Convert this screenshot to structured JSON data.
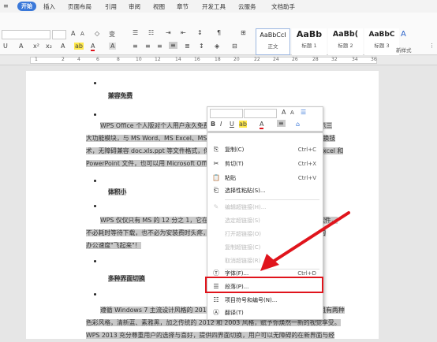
{
  "menubar": {
    "start": "开始",
    "items": [
      "插入",
      "页面布局",
      "引用",
      "审阅",
      "视图",
      "章节",
      "开发工具",
      "云服务",
      "文档助手"
    ]
  },
  "ribbon": {
    "font_size_up": "A",
    "font_size_down": "A",
    "clear": "◇",
    "phonetic": "变",
    "styles": [
      {
        "sample": "AaBbCcI",
        "label": "正文"
      },
      {
        "sample": "AaBb",
        "label": "标题 1"
      },
      {
        "sample": "AaBb(",
        "label": "标题 2"
      },
      {
        "sample": "AaBbC",
        "label": "标题 3"
      }
    ],
    "new_style": "新样式"
  },
  "ruler": {
    "marks": [
      "1",
      "2",
      "4",
      "6",
      "8",
      "10",
      "12",
      "14",
      "16",
      "18",
      "20",
      "22",
      "24",
      "26",
      "28",
      "32",
      "34",
      "36"
    ]
  },
  "doc": {
    "h1": "兼容免费",
    "p1": [
      "WPS Office 个人版对个人用户永久免费，包含 WPS 文字、WPS 表格、WPS 演示三",
      "大功能模块，与 MS Word、MS Excel、MS PowerPoint 一一对应，应用 XML 数据交换技",
      "术，无障碍兼容 doc.xls.ppt 等文件格式，你可以直接保存和打开 Microsoft Word、Excel 和",
      "PowerPoint 文件，也可以用 Microsoft Office 轻松编辑 WPS 系列文档。"
    ],
    "h2": "体积小",
    "p2": [
      "WPS 仅仅只有 MS 的 12 分之 1，它在不断优化的同时，体积依然保持小于同类软件，",
      "不必耗时等待下载，也不必为安装费时头疼，几分钟即可下载安装，启动速度快，让你的",
      "办公速度\"飞起来\"！"
    ],
    "h3": "多种界面切换",
    "p3": [
      "遵循 Windows 7 主流设计风格的 2012 新界面，metro 风格的 2013 界面，并且有两种",
      "色彩风格，清新蓝、素雅黑，加之传统的 2012 和 2003 风格，赋予你焕然一新的视觉享受。",
      "WPS 2013 充分尊重用户的选择与喜好，提供四界面切换，用户可以无障碍的在新界面与经"
    ]
  },
  "minitb": {
    "font": "",
    "size": "",
    "grow": "A",
    "shrink": "A",
    "line_spacing": "1"
  },
  "context_menu": {
    "items": [
      {
        "icon": "⎘",
        "label": "复制(C)",
        "shortcut": "Ctrl+C",
        "enabled": true
      },
      {
        "icon": "✂",
        "label": "剪切(T)",
        "shortcut": "Ctrl+X",
        "enabled": true
      },
      {
        "icon": "📋",
        "label": "粘贴",
        "shortcut": "Ctrl+V",
        "enabled": true
      },
      {
        "icon": "⎗",
        "label": "选择性粘贴(S)...",
        "shortcut": "",
        "enabled": true
      },
      {
        "icon": "✎",
        "label": "编辑超链接(H)...",
        "shortcut": "",
        "enabled": false
      },
      {
        "icon": "",
        "label": "选定超链接(S)",
        "shortcut": "",
        "enabled": false
      },
      {
        "icon": "",
        "label": "打开超链接(O)",
        "shortcut": "",
        "enabled": false
      },
      {
        "icon": "",
        "label": "复制超链接(C)",
        "shortcut": "",
        "enabled": false
      },
      {
        "icon": "",
        "label": "取消超链接(R)",
        "shortcut": "",
        "enabled": false
      },
      {
        "icon": "Ⓣ",
        "label": "字体(F)...",
        "shortcut": "Ctrl+D",
        "enabled": true
      },
      {
        "icon": "☰",
        "label": "段落(P)...",
        "shortcut": "",
        "enabled": true
      },
      {
        "icon": "☷",
        "label": "项目符号和编号(N)...",
        "shortcut": "",
        "enabled": true
      },
      {
        "icon": "Ⓐ",
        "label": "翻译(T)",
        "shortcut": "",
        "enabled": true
      }
    ]
  },
  "colors": {
    "accent": "#3a78d9",
    "highlight": "#e0141c",
    "arrow": "#e0141c"
  }
}
